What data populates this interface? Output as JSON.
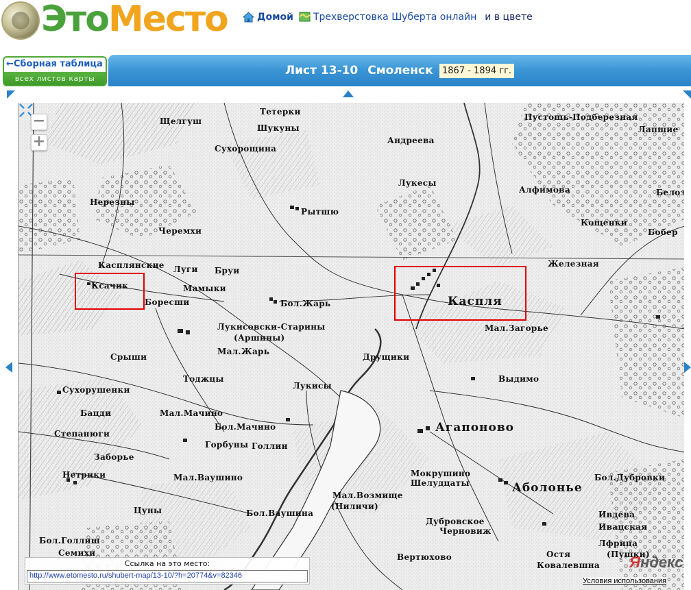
{
  "header": {
    "logo_part1": "Это",
    "logo_part2": "Место",
    "nav_home": "Домой",
    "nav_map": "Трехверстовка Шуберта онлайн",
    "nav_color": "и в цвете"
  },
  "summary_table": {
    "line1": "←Сборная таблица",
    "line2": "всех листов карты"
  },
  "title": {
    "sheet": "Лист 13-10",
    "city": "Смоленск",
    "years": "1867 - 1894 гг."
  },
  "map_labels": [
    "Тетерки",
    "Щелгуш",
    "Шукуны",
    "Сухорощина",
    "Андреева",
    "Пустошь-Подберезная",
    "Лапшие",
    "Лукесы",
    "Алфимова",
    "Белоз",
    "Нерезны",
    "Рытшю",
    "Кощенки",
    "Бобер",
    "Черемхи",
    "Касплянские",
    "Луги",
    "Бруи",
    "Ксачик",
    "Мамыки",
    "Боресши",
    "Бол.Жарь",
    "Каспля",
    "Железная",
    "Мал.Загорье",
    "Лукисовски-Старины",
    "(Аршины)",
    "Мал.Жарь",
    "Друщики",
    "Срыши",
    "Тоджцы",
    "Лукисы",
    "Выдимо",
    "Сухорушенки",
    "Бацди",
    "Мал.Мачино",
    "Бол.Мачино",
    "Степанюги",
    "Заборье",
    "Агапоново",
    "Горбуны",
    "Голлии",
    "Нетрики",
    "Мал.Ваушино",
    "Мокрушино",
    "Шелудцаты",
    "Аболонье",
    "Бол.Дубровки",
    "Мал.Возмище",
    "(Ниличи)",
    "Цуны",
    "Бол.Ваушина",
    "Дубровское",
    "Черновиж",
    "Бол.Голлиш",
    "Семихи",
    "Вертюхово",
    "Остя",
    "Ковалевшна",
    "Ивдева",
    "Ивацская",
    "Лфрица",
    "(Пушки)"
  ],
  "link_box": {
    "caption": "Ссылка на это место:",
    "url": "http://www.etomesto.ru/shubert-map/13-10/?h=20774&v=82346"
  },
  "map_controls": {
    "zoom_out": "−",
    "zoom_in": "+"
  },
  "footer": {
    "yandex_1": "Я",
    "yandex_2": "ндекс",
    "terms": "Условия использования"
  },
  "colors": {
    "logo_green": "#4aa23b",
    "logo_orange": "#f1a51f",
    "title_bar": "#2a82c8",
    "highlight": "#e00000"
  }
}
